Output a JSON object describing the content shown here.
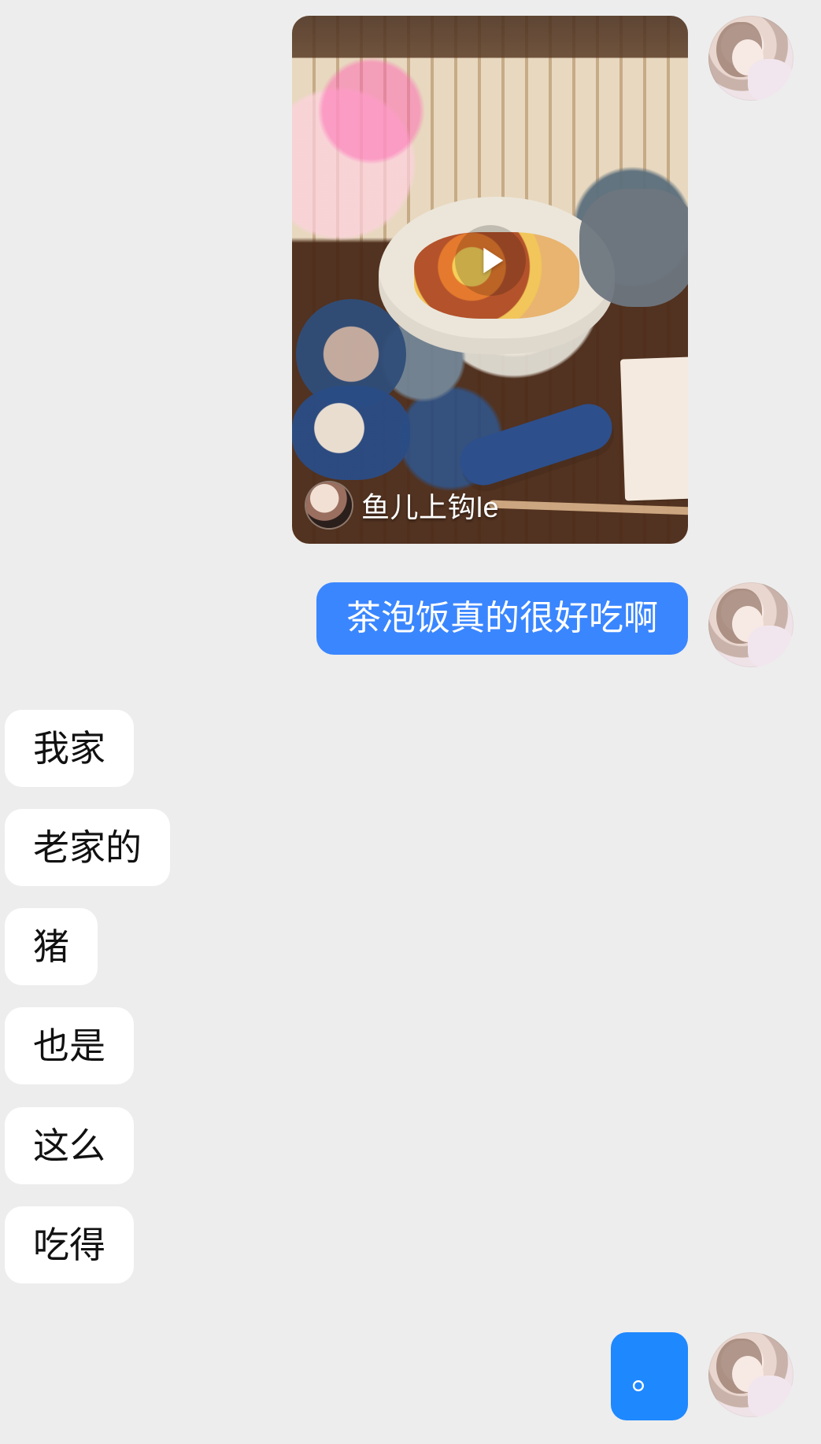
{
  "chat": {
    "messages": [
      {
        "type": "shared_video",
        "author_name": "鱼儿上钩le",
        "icons": {
          "play": "play-icon",
          "author_avatar": "author-avatar"
        }
      },
      {
        "type": "text_out",
        "text": "茶泡饭真的很好吃啊"
      },
      {
        "type": "text_in",
        "text": "我家"
      },
      {
        "type": "text_in",
        "text": "老家的"
      },
      {
        "type": "text_in",
        "text": "猪"
      },
      {
        "type": "text_in",
        "text": "也是"
      },
      {
        "type": "text_in",
        "text": "这么"
      },
      {
        "type": "text_in",
        "text": "吃得"
      },
      {
        "type": "text_out_short",
        "text": "。"
      }
    ]
  },
  "colors": {
    "background": "#ededed",
    "outgoing_bubble": "#3a86ff",
    "outgoing_bubble_short": "#1e88ff",
    "incoming_bubble": "#ffffff",
    "incoming_text": "#111111",
    "outgoing_text": "#ffffff"
  }
}
